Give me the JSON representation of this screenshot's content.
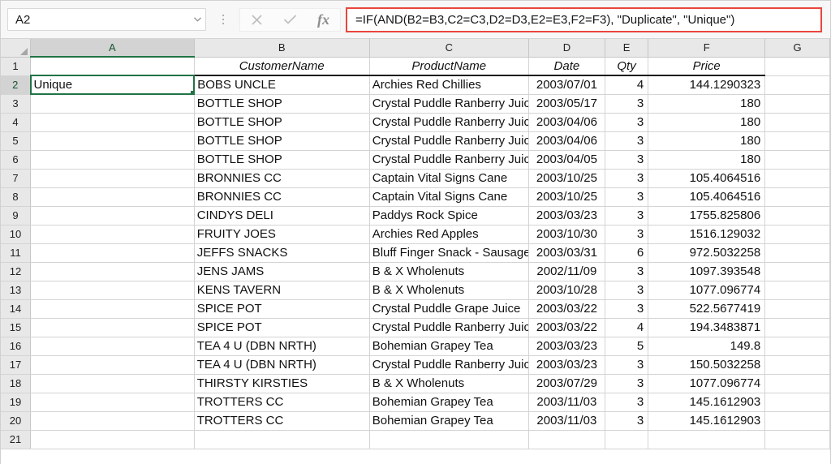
{
  "formula_bar": {
    "name_box_value": "A2",
    "name_box_icon": "chevron-down-icon",
    "cancel_icon": "close-icon",
    "confirm_icon": "check-icon",
    "function_icon": "fx-icon",
    "function_label": "fx",
    "formula_value": "=IF(AND(B2=B3,C2=C3,D2=D3,E2=E3,F2=F3), \"Duplicate\", \"Unique\")",
    "highlight_color": "#e8463c",
    "accent_color": "#217346"
  },
  "grid": {
    "column_headers": [
      "A",
      "B",
      "C",
      "D",
      "E",
      "F",
      "G"
    ],
    "selected_cell": "A2",
    "selected_row": "2",
    "selected_column": "A",
    "row_numbers": [
      "1",
      "2",
      "3",
      "4",
      "5",
      "6",
      "7",
      "8",
      "9",
      "10",
      "11",
      "12",
      "13",
      "14",
      "15",
      "16",
      "17",
      "18",
      "19",
      "20",
      "21"
    ],
    "header_row": {
      "A": "",
      "B": "CustomerName",
      "C": "ProductName",
      "D": "Date",
      "E": "Qty",
      "F": "Price",
      "G": ""
    },
    "rows": [
      {
        "row": "2",
        "A": "Unique",
        "B": "BOBS UNCLE",
        "C": "Archies Red Chillies",
        "D": "2003/07/01",
        "E": "4",
        "F": "144.1290323",
        "G": ""
      },
      {
        "row": "3",
        "A": "",
        "B": "BOTTLE SHOP",
        "C": "Crystal Puddle Ranberry Juice",
        "D": "2003/05/17",
        "E": "3",
        "F": "180",
        "G": ""
      },
      {
        "row": "4",
        "A": "",
        "B": "BOTTLE SHOP",
        "C": "Crystal Puddle Ranberry Juice",
        "D": "2003/04/06",
        "E": "3",
        "F": "180",
        "G": ""
      },
      {
        "row": "5",
        "A": "",
        "B": "BOTTLE SHOP",
        "C": "Crystal Puddle Ranberry Juice",
        "D": "2003/04/06",
        "E": "3",
        "F": "180",
        "G": ""
      },
      {
        "row": "6",
        "A": "",
        "B": "BOTTLE SHOP",
        "C": "Crystal Puddle Ranberry Juice",
        "D": "2003/04/05",
        "E": "3",
        "F": "180",
        "G": ""
      },
      {
        "row": "7",
        "A": "",
        "B": "BRONNIES  CC",
        "C": "Captain Vital Signs Cane",
        "D": "2003/10/25",
        "E": "3",
        "F": "105.4064516",
        "G": ""
      },
      {
        "row": "8",
        "A": "",
        "B": "BRONNIES  CC",
        "C": "Captain Vital Signs Cane",
        "D": "2003/10/25",
        "E": "3",
        "F": "105.4064516",
        "G": ""
      },
      {
        "row": "9",
        "A": "",
        "B": "CINDYS DELI",
        "C": "Paddys Rock Spice",
        "D": "2003/03/23",
        "E": "3",
        "F": "1755.825806",
        "G": ""
      },
      {
        "row": "10",
        "A": "",
        "B": "FRUITY JOES",
        "C": "Archies Red Apples",
        "D": "2003/10/30",
        "E": "3",
        "F": "1516.129032",
        "G": ""
      },
      {
        "row": "11",
        "A": "",
        "B": "JEFFS SNACKS",
        "C": "Bluff Finger Snack - Sausages",
        "D": "2003/03/31",
        "E": "6",
        "F": "972.5032258",
        "G": ""
      },
      {
        "row": "12",
        "A": "",
        "B": "JENS JAMS",
        "C": "B & X Wholenuts",
        "D": "2002/11/09",
        "E": "3",
        "F": "1097.393548",
        "G": ""
      },
      {
        "row": "13",
        "A": "",
        "B": "KENS TAVERN",
        "C": "B & X Wholenuts",
        "D": "2003/10/28",
        "E": "3",
        "F": "1077.096774",
        "G": ""
      },
      {
        "row": "14",
        "A": "",
        "B": "SPICE POT",
        "C": "Crystal Puddle Grape Juice",
        "D": "2003/03/22",
        "E": "3",
        "F": "522.5677419",
        "G": ""
      },
      {
        "row": "15",
        "A": "",
        "B": "SPICE POT",
        "C": "Crystal Puddle Ranberry Juice",
        "D": "2003/03/22",
        "E": "4",
        "F": "194.3483871",
        "G": ""
      },
      {
        "row": "16",
        "A": "",
        "B": "TEA 4 U (DBN NRTH)",
        "C": "Bohemian Grapey Tea",
        "D": "2003/03/23",
        "E": "5",
        "F": "149.8",
        "G": ""
      },
      {
        "row": "17",
        "A": "",
        "B": "TEA 4 U (DBN NRTH)",
        "C": "Crystal Puddle Ranberry Juice",
        "D": "2003/03/23",
        "E": "3",
        "F": "150.5032258",
        "G": ""
      },
      {
        "row": "18",
        "A": "",
        "B": "THIRSTY KIRSTIES",
        "C": "B & X Wholenuts",
        "D": "2003/07/29",
        "E": "3",
        "F": "1077.096774",
        "G": ""
      },
      {
        "row": "19",
        "A": "",
        "B": "TROTTERS CC",
        "C": "Bohemian Grapey Tea",
        "D": "2003/11/03",
        "E": "3",
        "F": "145.1612903",
        "G": ""
      },
      {
        "row": "20",
        "A": "",
        "B": "TROTTERS CC",
        "C": "Bohemian Grapey Tea",
        "D": "2003/11/03",
        "E": "3",
        "F": "145.1612903",
        "G": ""
      },
      {
        "row": "21",
        "A": "",
        "B": "",
        "C": "",
        "D": "",
        "E": "",
        "F": "",
        "G": ""
      }
    ]
  }
}
